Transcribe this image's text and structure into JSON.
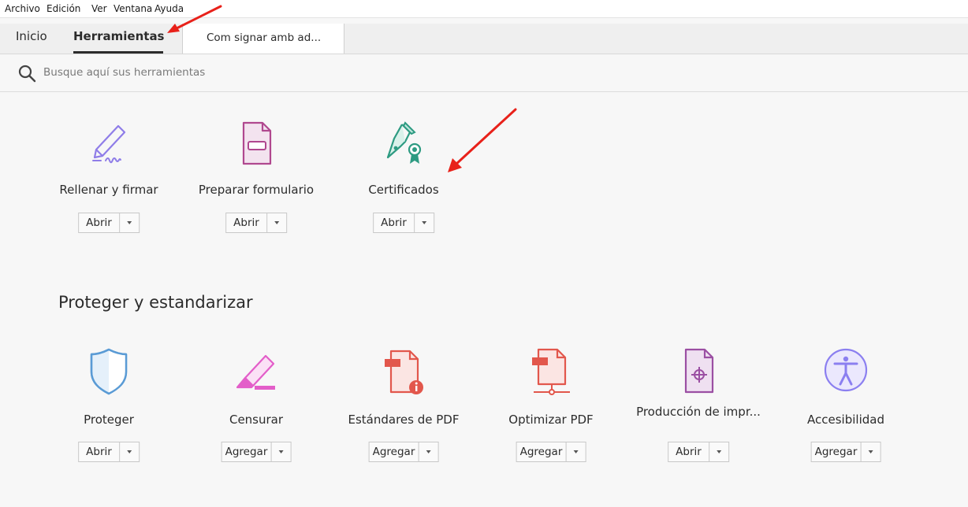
{
  "menubar": {
    "items": [
      "Archivo",
      "Edición",
      "Ver",
      "Ventana",
      "Ayuda"
    ]
  },
  "tabs": {
    "home": "Inicio",
    "tools": "Herramientas",
    "document": "Com signar amb ad..."
  },
  "search": {
    "placeholder": "Busque aquí sus herramientas",
    "value": ""
  },
  "tools_top": [
    {
      "name": "Rellenar y firmar",
      "button": "Abrir",
      "icon": "fill-sign-icon"
    },
    {
      "name": "Preparar formulario",
      "button": "Abrir",
      "icon": "prepare-form-icon"
    },
    {
      "name": "Certificados",
      "button": "Abrir",
      "icon": "certificates-icon"
    }
  ],
  "section": {
    "title": "Proteger y estandarizar"
  },
  "tools_protect": [
    {
      "name": "Proteger",
      "button": "Abrir",
      "icon": "protect-shield-icon"
    },
    {
      "name": "Censurar",
      "button": "Agregar",
      "icon": "redact-icon"
    },
    {
      "name": "Estándares de PDF",
      "button": "Agregar",
      "icon": "pdf-standards-icon"
    },
    {
      "name": "Optimizar PDF",
      "button": "Agregar",
      "icon": "optimize-pdf-icon"
    },
    {
      "name": "Producción de impr...",
      "button": "Abrir",
      "icon": "print-production-icon"
    },
    {
      "name": "Accesibilidad",
      "button": "Agregar",
      "icon": "accessibility-icon"
    }
  ],
  "colors": {
    "annotation_arrow": "#e8211a",
    "fill_sign": "#8f7de8",
    "prepare_form": "#b0488f",
    "certificates": "#2e9b82",
    "protect": "#5a9bd5",
    "redact": "#e35ec9",
    "pdf_standards": "#e2574c",
    "print_production": "#9b4fa3",
    "accessibility": "#8b7ff0"
  }
}
